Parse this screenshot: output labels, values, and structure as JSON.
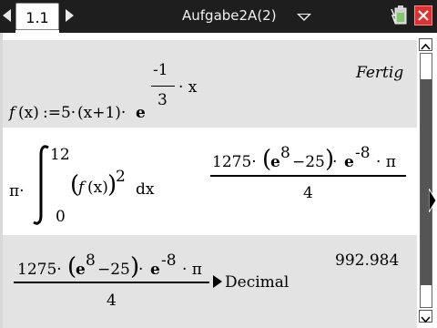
{
  "tab": {
    "label": "1.1"
  },
  "document": {
    "title": "Aufgabe2A(2)"
  },
  "entry1": {
    "lhs_f": "f",
    "lhs_x": "(x)",
    "assign": ":=5·",
    "factor": "(x+1)·",
    "base": "e",
    "exp_num": "-1",
    "exp_den": "3",
    "exp_var": "· x",
    "result": "Fertig"
  },
  "entry2": {
    "pi": "π·",
    "upper": "12",
    "lower": "0",
    "integrand_f": "f",
    "integrand_x": "(x)",
    "square": "2",
    "dx": "dx",
    "result_numer_a": "1275·",
    "result_e1": "e",
    "result_exp1": "8",
    "result_mid": "−25",
    "result_e2": "e",
    "result_exp2": "-8",
    "result_tail": "· π",
    "result_denom": "4"
  },
  "entry3": {
    "numer_a": "1275·",
    "e1": "e",
    "exp1": "8",
    "mid": "−25",
    "e2": "e",
    "exp2": "-8",
    "tail": "· π",
    "denom": "4",
    "op": "Decimal",
    "result": "992.984"
  },
  "colors": {
    "topbar": "#1e1e1e",
    "row_shaded": "#e3e3e3",
    "close_button": "#e03030"
  }
}
